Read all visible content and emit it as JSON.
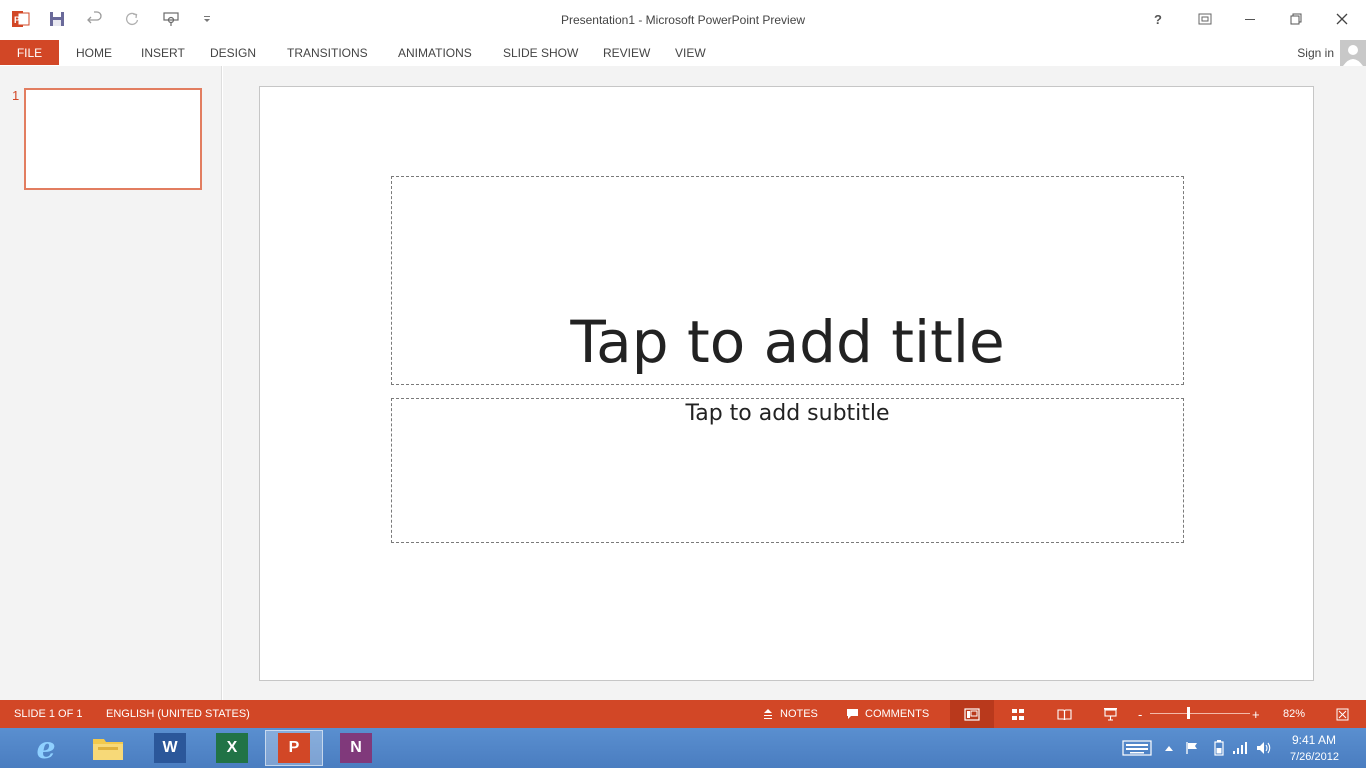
{
  "window": {
    "title": "Presentation1 - Microsoft PowerPoint Preview",
    "help_label": "?"
  },
  "ribbon": {
    "file_tab": "FILE",
    "tabs": [
      "HOME",
      "INSERT",
      "DESIGN",
      "TRANSITIONS",
      "ANIMATIONS",
      "SLIDE SHOW",
      "REVIEW",
      "VIEW"
    ],
    "sign_in": "Sign in"
  },
  "thumbnails": {
    "items": [
      {
        "number": "1"
      }
    ]
  },
  "slide": {
    "title_placeholder": "Tap to add title",
    "subtitle_placeholder": "Tap to add subtitle"
  },
  "statusbar": {
    "slide_counter": "SLIDE 1 OF 1",
    "language": "ENGLISH (UNITED STATES)",
    "notes_label": "NOTES",
    "comments_label": "COMMENTS",
    "zoom_minus": "-",
    "zoom_plus": "+",
    "zoom_level": "82%",
    "zoom_fraction": 0.38
  },
  "taskbar": {
    "apps": [
      {
        "name": "internet-explorer",
        "label": "e"
      },
      {
        "name": "file-explorer",
        "label": ""
      },
      {
        "name": "word",
        "label": "W"
      },
      {
        "name": "excel",
        "label": "X"
      },
      {
        "name": "powerpoint",
        "label": "P"
      },
      {
        "name": "onenote",
        "label": "N"
      }
    ],
    "clock_time": "9:41 AM",
    "clock_date": "7/26/2012"
  },
  "colors": {
    "accent": "#d24726",
    "taskbar": "#4a7dc0"
  }
}
